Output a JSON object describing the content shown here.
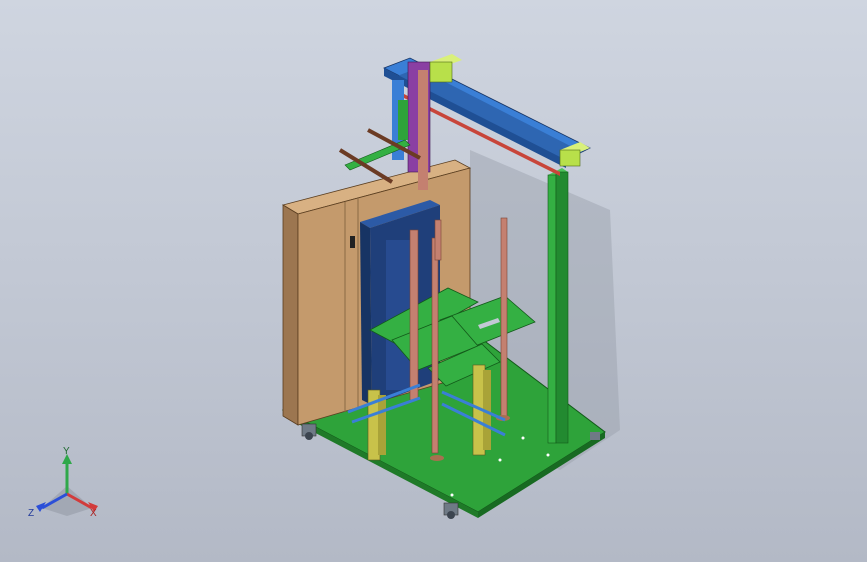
{
  "viewport": {
    "background_top": "#cfd5e0",
    "background_bottom": "#b3b9c6"
  },
  "colors": {
    "cabinet": "#c49a6c",
    "cabinet_side": "#9c7650",
    "base_plate": "#2ea33a",
    "green_part": "#34b043",
    "blue_rail": "#3a7fd6",
    "navy_frame": "#1f3f7a",
    "copper_rod": "#c48070",
    "yellow_bracket": "#c8c24a",
    "purple_slide": "#8a3fa3",
    "brown_rod": "#6b3b24",
    "motor": "#b8e04a"
  },
  "triad": {
    "y_label": "Y",
    "x_label": "X",
    "z_label": "Z",
    "y_color": "#2fa84a",
    "x_color": "#d23b3b",
    "z_color": "#2b4fd8"
  }
}
